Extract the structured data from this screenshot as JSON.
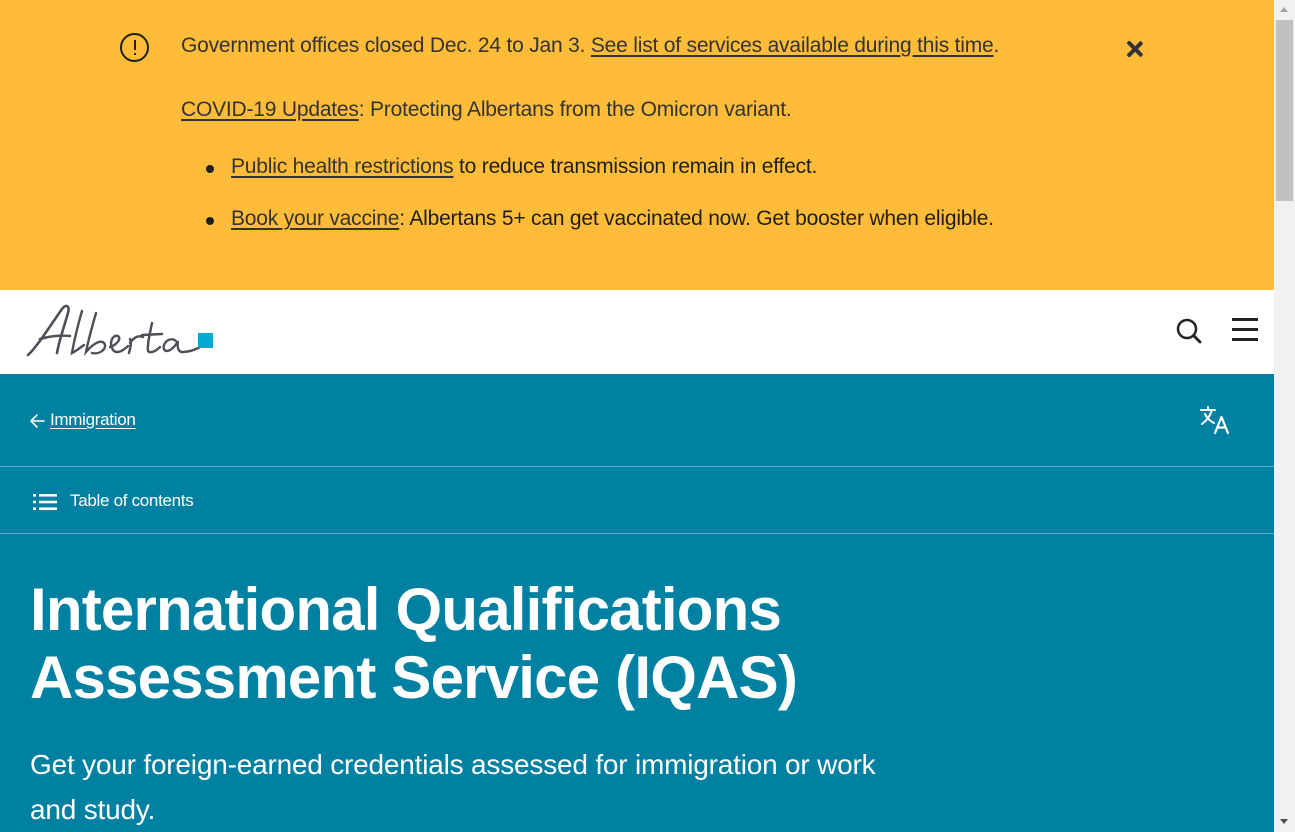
{
  "alert": {
    "line1_text": "Government offices closed Dec. 24 to Jan 3. ",
    "line1_link": "See list of services available during this time",
    "line1_end": ".",
    "line2_link": "COVID-19 Updates",
    "line2_text": ": Protecting Albertans from the Omicron variant.",
    "items": [
      {
        "link": "Public health restrictions",
        "text": " to reduce transmission remain in effect."
      },
      {
        "link": "Book your vaccine",
        "text": ": Albertans 5+ can get vaccinated now. Get booster when eligible."
      }
    ],
    "colors": {
      "background": "#febc38",
      "text": "#333333"
    }
  },
  "header": {
    "logo_text": "Alberta",
    "search_icon": "search-icon",
    "menu_icon": "hamburger-menu-icon"
  },
  "hero": {
    "back_link": "Immigration",
    "translate_icon": "translate-icon",
    "toc_label": "Table of contents",
    "title_line1": "International Qualifications",
    "title_line2": "Assessment Service (IQAS)",
    "lead": "Get your foreign-earned credentials assessed for immigration or work and study.",
    "colors": {
      "background": "#0081a2",
      "text": "#ffffff"
    }
  },
  "brand": {
    "accent": "#00aad2"
  }
}
